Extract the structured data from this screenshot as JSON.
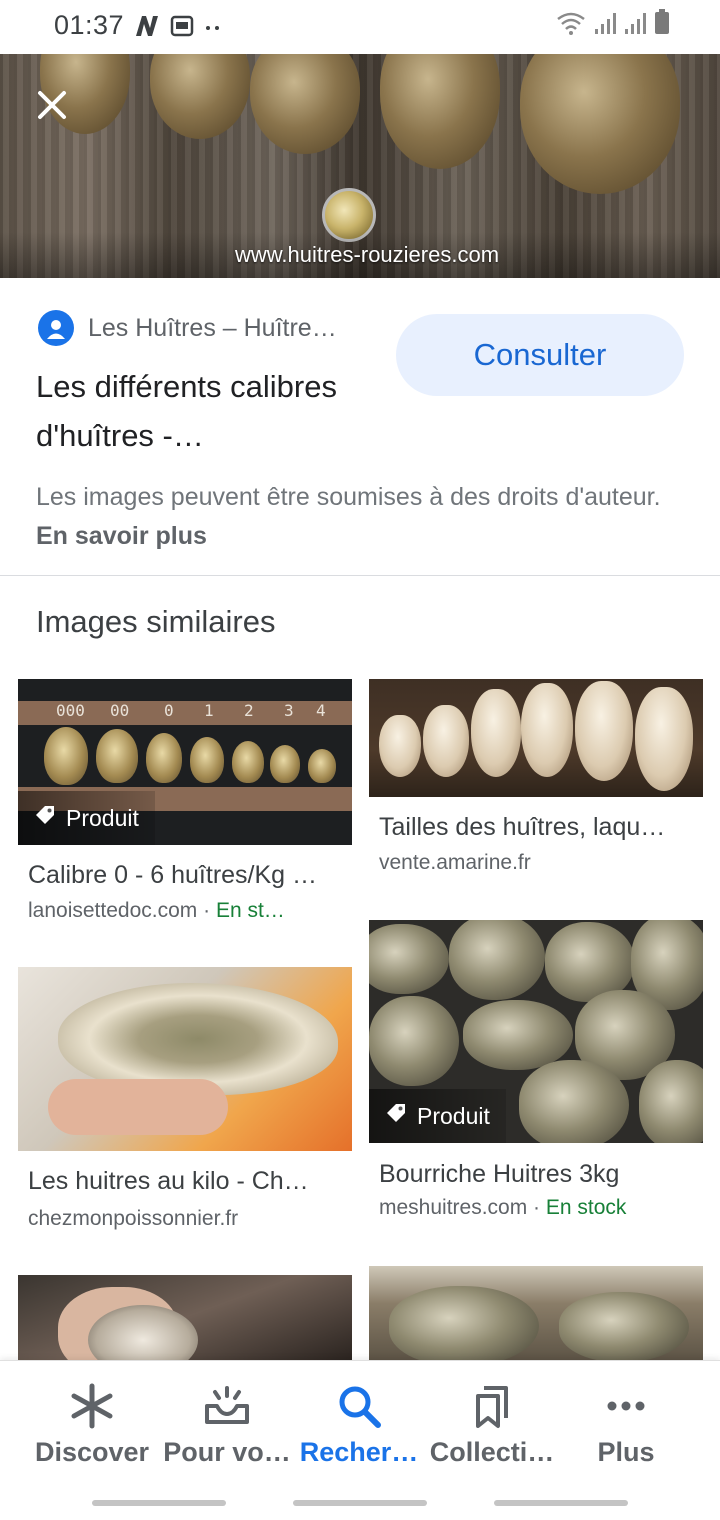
{
  "status_bar": {
    "time": "01:37",
    "left_icons": [
      "n-icon",
      "screenshot-icon",
      "more-dots-icon"
    ],
    "right_icons": [
      "wifi-icon",
      "signal-icon",
      "signal-icon",
      "battery-icon"
    ]
  },
  "hero": {
    "watermark": "www.huitres-rouzieres.com",
    "close_icon": "close-icon"
  },
  "source": {
    "name": "Les Huîtres – Huître…",
    "title": "Les différents calibres d'huîtres -…",
    "consult_label": "Consulter"
  },
  "copyright": {
    "text": "Les images peuvent être soumises à des droits d'auteur.",
    "link": "En savoir plus"
  },
  "similar": {
    "heading": "Images similaires",
    "product_label": "Produit",
    "cards": [
      {
        "title": "Calibre 0 - 6 huîtres/Kg …",
        "site": "lanoisettedoc.com",
        "extra": "En st…",
        "caliber_numbers": [
          "000",
          "00",
          "0",
          "1",
          "2",
          "3",
          "4"
        ]
      },
      {
        "title": "Tailles des huîtres, laqu…",
        "site": "vente.amarine.fr"
      },
      {
        "title": "Les huitres au kilo - Ch…",
        "site": "chezmonpoissonnier.fr"
      },
      {
        "title": "Bourriche Huitres 3kg",
        "site": "meshuitres.com",
        "extra": "En stock"
      }
    ]
  },
  "bottom_nav": {
    "items": [
      {
        "label": "Discover",
        "icon": "asterisk-icon"
      },
      {
        "label": "Pour vo…",
        "icon": "inbox-update-icon"
      },
      {
        "label": "Recher…",
        "icon": "search-icon"
      },
      {
        "label": "Collecti…",
        "icon": "collections-icon"
      },
      {
        "label": "Plus",
        "icon": "more-icon"
      }
    ],
    "active": "Recher…"
  },
  "colors": {
    "accent": "#1a73e8",
    "consult_bg": "#e8f0fe",
    "in_stock": "#188038"
  }
}
